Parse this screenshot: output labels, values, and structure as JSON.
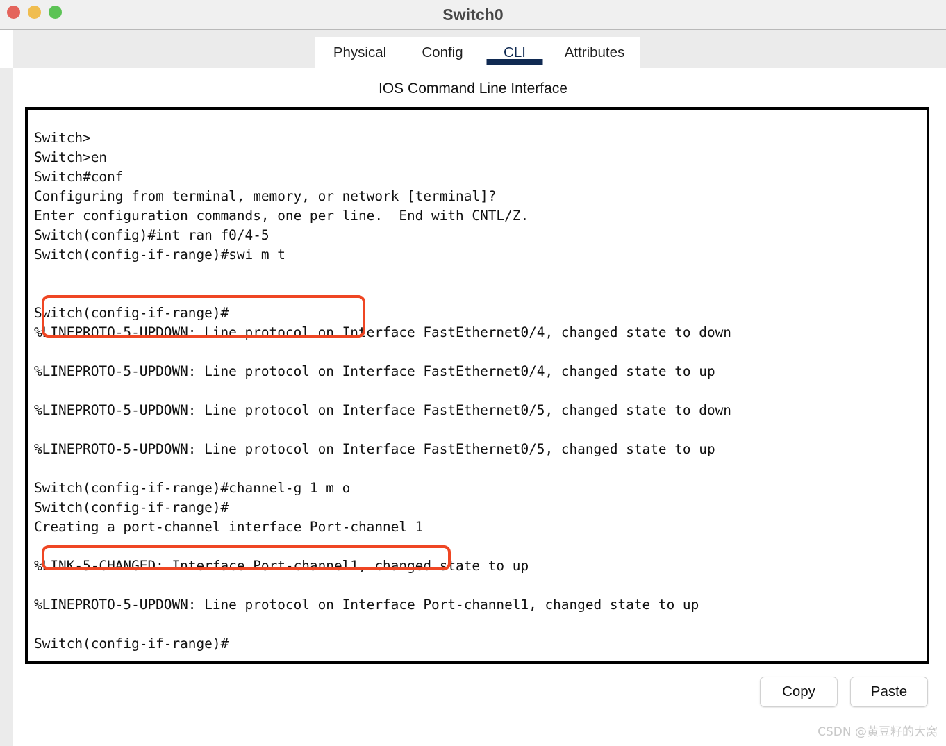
{
  "window": {
    "title": "Switch0",
    "traffic_lights": [
      {
        "name": "close",
        "color": "#e4645c"
      },
      {
        "name": "minimize",
        "color": "#f0bd4f"
      },
      {
        "name": "zoom",
        "color": "#5cc355"
      }
    ]
  },
  "tabs": [
    {
      "id": "physical",
      "label": "Physical",
      "active": false
    },
    {
      "id": "config",
      "label": "Config",
      "active": false
    },
    {
      "id": "cli",
      "label": "CLI",
      "active": true
    },
    {
      "id": "attributes",
      "label": "Attributes",
      "active": false
    }
  ],
  "main": {
    "heading": "IOS Command Line Interface",
    "terminal_text": "Switch>\nSwitch>en\nSwitch#conf\nConfiguring from terminal, memory, or network [terminal]?\nEnter configuration commands, one per line.  End with CNTL/Z.\nSwitch(config)#int ran f0/4-5\nSwitch(config-if-range)#swi m t\n\n\nSwitch(config-if-range)#\n%LINEPROTO-5-UPDOWN: Line protocol on Interface FastEthernet0/4, changed state to down\n\n%LINEPROTO-5-UPDOWN: Line protocol on Interface FastEthernet0/4, changed state to up\n\n%LINEPROTO-5-UPDOWN: Line protocol on Interface FastEthernet0/5, changed state to down\n\n%LINEPROTO-5-UPDOWN: Line protocol on Interface FastEthernet0/5, changed state to up\n\nSwitch(config-if-range)#channel-g 1 m o\nSwitch(config-if-range)#\nCreating a port-channel interface Port-channel 1\n\n%LINK-5-CHANGED: Interface Port-channel1, changed state to up\n\n%LINEPROTO-5-UPDOWN: Line protocol on Interface Port-channel1, changed state to up\n\nSwitch(config-if-range)#",
    "terminal_lines": [
      "Switch>",
      "Switch>en",
      "Switch#conf",
      "Configuring from terminal, memory, or network [terminal]?",
      "Enter configuration commands, one per line.  End with CNTL/Z.",
      "Switch(config)#int ran f0/4-5",
      "Switch(config-if-range)#swi m t",
      "",
      "",
      "Switch(config-if-range)#",
      "%LINEPROTO-5-UPDOWN: Line protocol on Interface FastEthernet0/4, changed state to down",
      "",
      "%LINEPROTO-5-UPDOWN: Line protocol on Interface FastEthernet0/4, changed state to up",
      "",
      "%LINEPROTO-5-UPDOWN: Line protocol on Interface FastEthernet0/5, changed state to down",
      "",
      "%LINEPROTO-5-UPDOWN: Line protocol on Interface FastEthernet0/5, changed state to up",
      "",
      "Switch(config-if-range)#channel-g 1 m o",
      "Switch(config-if-range)#",
      "Creating a port-channel interface Port-channel 1",
      "",
      "%LINK-5-CHANGED: Interface Port-channel1, changed state to up",
      "",
      "%LINEPROTO-5-UPDOWN: Line protocol on Interface Port-channel1, changed state to up",
      "",
      "Switch(config-if-range)#"
    ],
    "highlights": [
      {
        "name": "highlight-int-range-commands",
        "color": "#ef4623"
      },
      {
        "name": "highlight-channel-group-command",
        "color": "#ef4623"
      }
    ]
  },
  "buttons": {
    "copy": "Copy",
    "paste": "Paste"
  },
  "watermark": "CSDN @黄豆籽的大窝",
  "colors": {
    "accent": "#102a52",
    "highlight": "#ef4623",
    "titlebar": "#f0f0f0",
    "tabstrip": "#ebebeb"
  }
}
